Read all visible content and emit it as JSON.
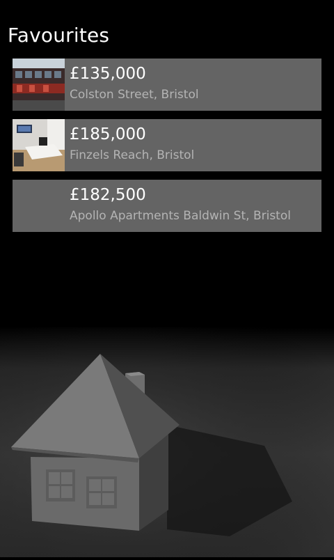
{
  "page": {
    "title": "Favourites"
  },
  "favourites": [
    {
      "price": "£135,000",
      "address": "Colston Street, Bristol",
      "thumbnail": "building-exterior-photo"
    },
    {
      "price": "£185,000",
      "address": "Finzels Reach, Bristol",
      "thumbnail": "apartment-interior-photo"
    },
    {
      "price": "£182,500",
      "address": "Apollo Apartments Baldwin St, Bristol",
      "thumbnail": ""
    }
  ],
  "colors": {
    "background": "#000000",
    "tile": "#646464",
    "subtitle": "#b4b4b4"
  },
  "background_image": "house-model-illustration"
}
